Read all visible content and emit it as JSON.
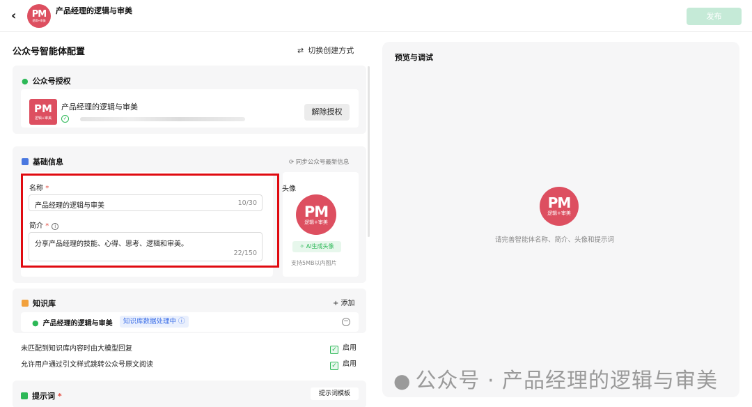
{
  "header": {
    "back_icon": "chevron-left-icon",
    "back_glyph": "‹",
    "logo": {
      "mark": "PM",
      "sub": "逻辑+审美"
    },
    "title": "产品经理的逻辑与审美",
    "publish_label": "发布"
  },
  "config": {
    "title": "公众号智能体配置",
    "switch_icon": "⇄",
    "switch_label": "切换创建方式",
    "auth": {
      "heading": "公众号授权",
      "account_name": "产品经理的逻辑与审美",
      "logo": {
        "mark": "PM",
        "sub": "逻辑+审美"
      },
      "unauth_label": "解除授权"
    },
    "basic": {
      "heading": "基础信息",
      "sync_label": "同步公众号最新信息",
      "name_label": "名称",
      "name_value": "产品经理的逻辑与审美",
      "name_counter": "10/30",
      "desc_label": "简介",
      "desc_value": "分享产品经理的技能、心得、思考、逻辑和审美。",
      "desc_counter": "22/150",
      "required_mark": "*",
      "avatar_label": "头像",
      "avatar_logo": {
        "mark": "PM",
        "sub": "逻辑+审美"
      },
      "ai_avatar_label": "AI生成头像",
      "size_hint": "支持5MB以内图片"
    },
    "knowledge": {
      "heading": "知识库",
      "add_label": "+ 添加",
      "item_name": "产品经理的逻辑与审美",
      "item_status": "知识库数据处理中",
      "options": [
        {
          "label": "未匹配到知识库内容时由大模型回复",
          "state": "启用"
        },
        {
          "label": "允许用户通过引文样式跳转公众号原文阅读",
          "state": "启用"
        }
      ]
    },
    "prompt": {
      "heading": "提示词",
      "template_label": "提示词模板"
    }
  },
  "preview": {
    "title": "预览与调试",
    "logo": {
      "mark": "PM",
      "sub": "逻辑+审美"
    },
    "hint": "请完善智能体名称、简介、头像和提示词",
    "watermark": "公众号 · 产品经理的逻辑与审美"
  },
  "colors": {
    "brand_red": "#dd4f60",
    "wechat_green": "#2db857",
    "highlight_red": "#e00a10",
    "publish_disabled": "#c5ead7"
  }
}
